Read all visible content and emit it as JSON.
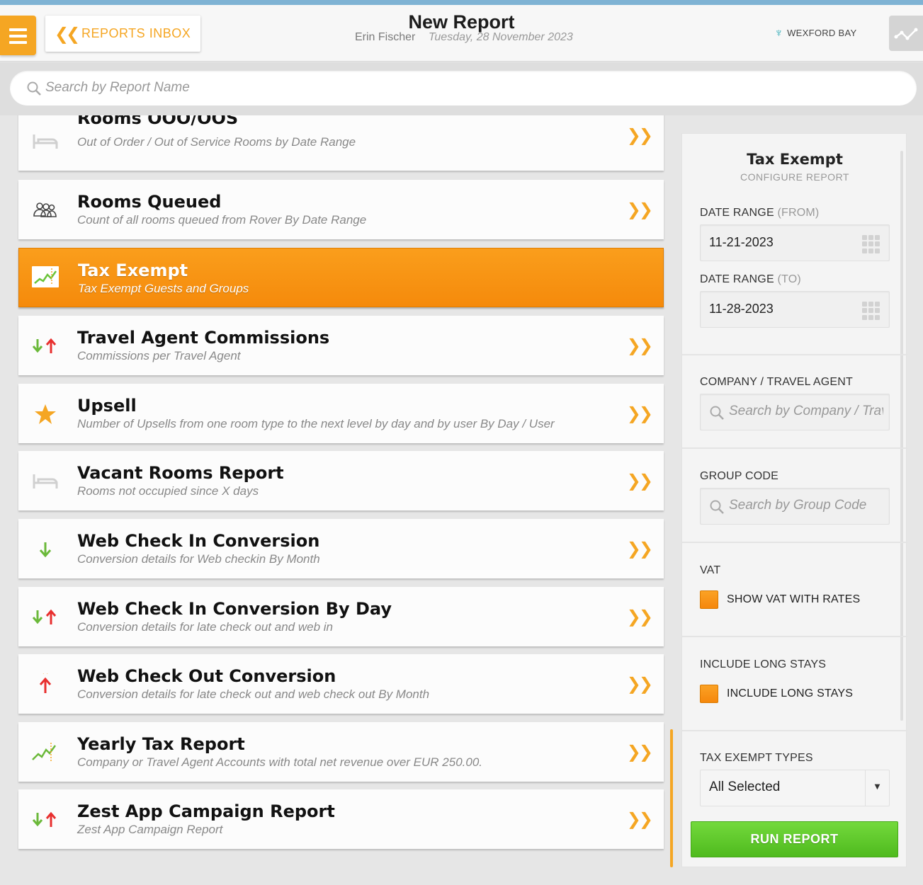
{
  "header": {
    "title": "New Report",
    "user": "Erin Fischer",
    "date": "Tuesday, 28 November 2023",
    "back_label": "REPORTS INBOX",
    "hotel_name": "WEXFORD BAY",
    "accent_color": "#f5a623"
  },
  "search": {
    "placeholder": "Search by Report Name"
  },
  "reports": [
    {
      "name": "Rooms OOO/OOS",
      "description": "Out of Order / Out of Service Rooms by Date Range",
      "icon": "bed-icon"
    },
    {
      "name": "Rooms Queued",
      "description": "Count of all rooms queued from Rover By Date Range",
      "icon": "guests-icon"
    },
    {
      "name": "Tax Exempt",
      "description": "Tax Exempt Guests and Groups",
      "icon": "chart-icon",
      "selected": true
    },
    {
      "name": "Travel Agent Commissions",
      "description": "Commissions per Travel Agent",
      "icon": "arrows-icon"
    },
    {
      "name": "Upsell",
      "description": "Number of Upsells from one room type to the next level by day and by user By Day / User",
      "icon": "star-icon"
    },
    {
      "name": "Vacant Rooms Report",
      "description": "Rooms not occupied since X days",
      "icon": "bed-icon"
    },
    {
      "name": "Web Check In Conversion",
      "description": "Conversion details for Web checkin By Month",
      "icon": "arrow-down-icon"
    },
    {
      "name": "Web Check In Conversion By Day",
      "description": "Conversion details for late check out and web in",
      "icon": "arrows-icon"
    },
    {
      "name": "Web Check Out Conversion",
      "description": "Conversion details for late check out and web check out By Month",
      "icon": "arrow-up-icon"
    },
    {
      "name": "Yearly Tax Report",
      "description": "Company or Travel Agent Accounts with total net revenue over EUR 250.00.",
      "icon": "chart-icon"
    },
    {
      "name": "Zest App Campaign Report",
      "description": "Zest App Campaign Report",
      "icon": "arrows-icon"
    }
  ],
  "config": {
    "title": "Tax Exempt",
    "subtitle": "CONFIGURE REPORT",
    "date_from_label": "DATE RANGE",
    "date_from_hint": "(FROM)",
    "date_from_value": "11-21-2023",
    "date_to_label": "DATE RANGE",
    "date_to_hint": "(TO)",
    "date_to_value": "11-28-2023",
    "company_label": "COMPANY / TRAVEL AGENT",
    "company_placeholder": "Search by Company / Trav",
    "group_label": "GROUP CODE",
    "group_placeholder": "Search by Group Code",
    "vat_label": "VAT",
    "vat_option": "SHOW VAT WITH RATES",
    "long_stays_label": "INCLUDE LONG STAYS",
    "long_stays_option": "INCLUDE LONG STAYS",
    "tax_types_label": "TAX EXEMPT TYPES",
    "tax_types_value": "All Selected",
    "run_label": "RUN REPORT"
  }
}
